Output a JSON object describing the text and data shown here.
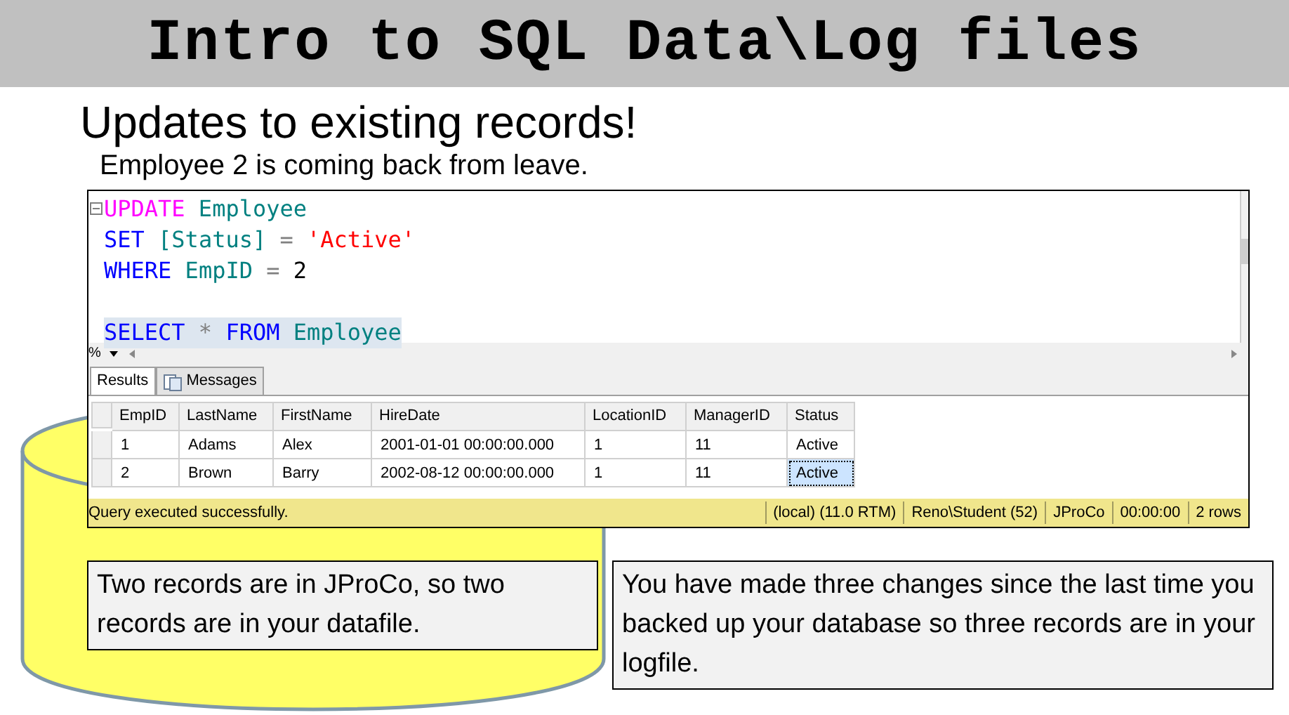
{
  "slide_title": "Intro to SQL Data\\Log files",
  "heading": "Updates to existing records!",
  "subheading": "Employee 2 is coming back from leave.",
  "editor": {
    "code_lines": [
      {
        "kind": "code",
        "selected": false,
        "tokens": [
          {
            "kind": "dml",
            "text": "UPDATE"
          },
          {
            "kind": "ident",
            "text": " Employee"
          }
        ]
      },
      {
        "kind": "code",
        "selected": false,
        "tokens": [
          {
            "kind": "keyword",
            "text": "SET"
          },
          {
            "kind": "ident",
            "text": " [Status]"
          },
          {
            "kind": "operator",
            "text": " ="
          },
          {
            "kind": "string",
            "text": " 'Active'"
          }
        ]
      },
      {
        "kind": "code",
        "selected": false,
        "tokens": [
          {
            "kind": "keyword",
            "text": "WHERE"
          },
          {
            "kind": "ident",
            "text": " EmpID"
          },
          {
            "kind": "operator",
            "text": " ="
          },
          {
            "kind": "number",
            "text": " 2"
          }
        ]
      },
      {
        "kind": "blank"
      },
      {
        "kind": "code",
        "selected": true,
        "tokens": [
          {
            "kind": "keyword",
            "text": "SELECT"
          },
          {
            "kind": "operator",
            "text": " *"
          },
          {
            "kind": "keyword",
            "text": " FROM"
          },
          {
            "kind": "ident",
            "text": " Employee"
          }
        ]
      }
    ],
    "zoom": "%"
  },
  "tabs": [
    {
      "label": "Results",
      "selected": true
    },
    {
      "label": "Messages",
      "selected": false
    }
  ],
  "grid": {
    "columns": [
      "EmpID",
      "LastName",
      "FirstName",
      "HireDate",
      "LocationID",
      "ManagerID",
      "Status"
    ],
    "rows": [
      {
        "cells": [
          {
            "text": "1",
            "selected": false
          },
          {
            "text": "Adams",
            "selected": false
          },
          {
            "text": "Alex",
            "selected": false
          },
          {
            "text": "2001-01-01 00:00:00.000",
            "selected": false
          },
          {
            "text": "1",
            "selected": false
          },
          {
            "text": "11",
            "selected": false
          },
          {
            "text": "Active",
            "selected": false
          }
        ]
      },
      {
        "cells": [
          {
            "text": "2",
            "selected": false
          },
          {
            "text": "Brown",
            "selected": false
          },
          {
            "text": "Barry",
            "selected": false
          },
          {
            "text": "2002-08-12 00:00:00.000",
            "selected": false
          },
          {
            "text": "1",
            "selected": false
          },
          {
            "text": "11",
            "selected": false
          },
          {
            "text": "Active",
            "selected": true
          }
        ]
      }
    ]
  },
  "status_bar": {
    "message": "Query executed successfully.",
    "segments": [
      "(local) (11.0 RTM)",
      "Reno\\Student (52)",
      "JProCo",
      "00:00:00",
      "2 rows"
    ]
  },
  "callouts": [
    "Two records are in JProCo, so two records are in your datafile.",
    "You have made three changes since the last time you backed up your database so three records are in your logfile."
  ]
}
